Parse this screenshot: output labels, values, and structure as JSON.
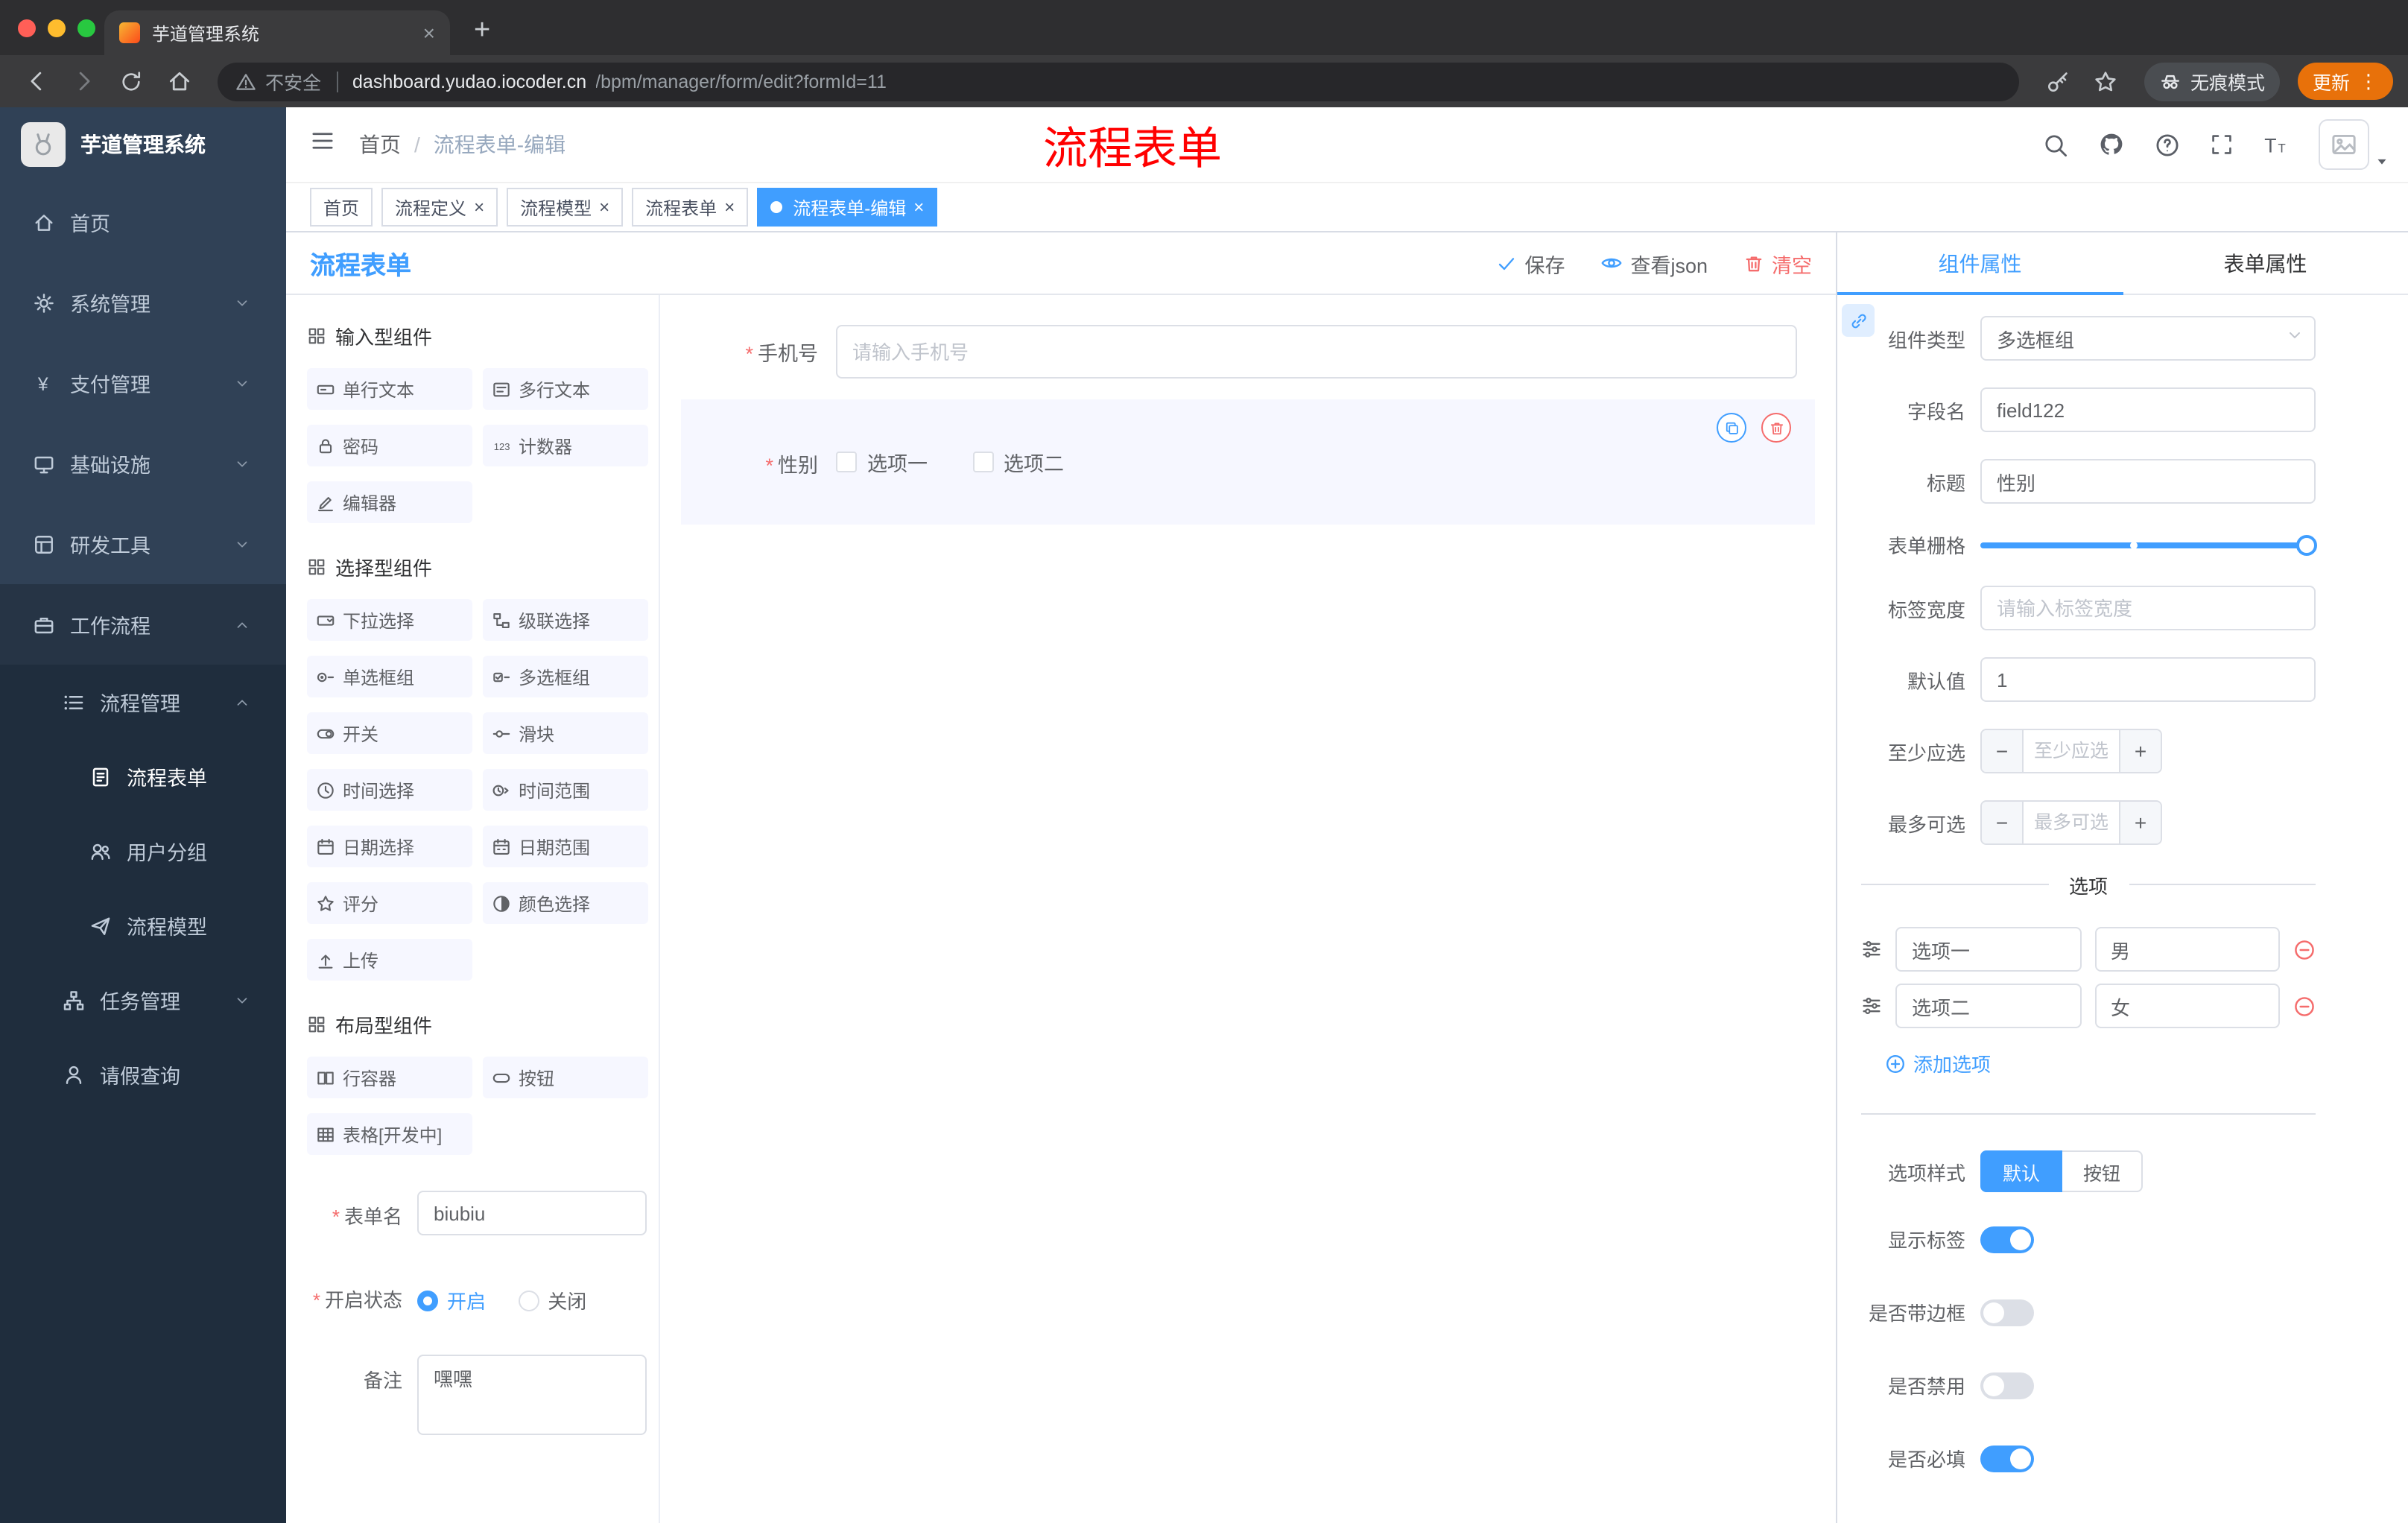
{
  "browser": {
    "tab_title": "芋道管理系统",
    "new_tab": "+",
    "tab_close": "×",
    "security_label": "不安全",
    "url_host": "dashboard.yudao.iocoder.cn",
    "url_path": "/bpm/manager/form/edit?formId=11",
    "incognito_label": "无痕模式",
    "update_label": "更新",
    "kebab": "⋮"
  },
  "sidebar": {
    "logo_title": "芋道管理系统",
    "menu": [
      {
        "name": "home",
        "label": "首页",
        "icon": "home-icon",
        "level": 1
      },
      {
        "name": "system-management",
        "label": "系统管理",
        "icon": "gear-icon",
        "level": 1,
        "chevron": "down"
      },
      {
        "name": "payment-management",
        "label": "支付管理",
        "icon": "payment-icon",
        "level": 1,
        "chevron": "down"
      },
      {
        "name": "infrastructure",
        "label": "基础设施",
        "icon": "infrastructure-icon",
        "level": 1,
        "chevron": "down"
      },
      {
        "name": "devtools",
        "label": "研发工具",
        "icon": "devtools-icon",
        "level": 1,
        "chevron": "down"
      },
      {
        "name": "workflow",
        "label": "工作流程",
        "icon": "workflow-icon",
        "level": 1,
        "chevron": "up",
        "open": true
      },
      {
        "name": "process-management",
        "label": "流程管理",
        "icon": "process-management-icon",
        "level": 2,
        "chevron": "up",
        "open": true
      },
      {
        "name": "process-form",
        "label": "流程表单",
        "icon": "process-form-icon",
        "level": 3,
        "active": true
      },
      {
        "name": "user-group",
        "label": "用户分组",
        "icon": "user-group-icon",
        "level": 3
      },
      {
        "name": "process-model",
        "label": "流程模型",
        "icon": "process-model-icon",
        "level": 3
      },
      {
        "name": "task-management",
        "label": "任务管理",
        "icon": "task-management-icon",
        "level": 2,
        "chevron": "down"
      },
      {
        "name": "leave-query",
        "label": "请假查询",
        "icon": "leave-query-icon",
        "level": 2
      }
    ]
  },
  "header": {
    "breadcrumb": [
      "首页",
      "流程表单-编辑"
    ],
    "breadcrumb_sep": "/",
    "annotation": {
      "text": "流程表单",
      "color": "#ff0000"
    }
  },
  "tags": [
    {
      "name": "home",
      "label": "首页",
      "closable": false,
      "active": false
    },
    {
      "name": "process-definition",
      "label": "流程定义",
      "closable": true,
      "active": false
    },
    {
      "name": "process-model",
      "label": "流程模型",
      "closable": true,
      "active": false
    },
    {
      "name": "process-form",
      "label": "流程表单",
      "closable": true,
      "active": false
    },
    {
      "name": "process-form-edit",
      "label": "流程表单-编辑",
      "closable": true,
      "active": true
    }
  ],
  "designer": {
    "title": "流程表单",
    "actions": [
      {
        "name": "save",
        "label": "保存",
        "icon": "check-icon",
        "type": "default"
      },
      {
        "name": "view-json",
        "label": "查看json",
        "icon": "eye-icon",
        "type": "default"
      },
      {
        "name": "clear",
        "label": "清空",
        "icon": "trash-icon",
        "type": "danger"
      }
    ]
  },
  "palette": {
    "sections": [
      {
        "name": "input-components",
        "title": "输入型组件",
        "icon": "section-icon",
        "items": [
          {
            "name": "single-line-text",
            "label": "单行文本",
            "icon": "single-line-text-icon"
          },
          {
            "name": "multi-line-text",
            "label": "多行文本",
            "icon": "multi-line-text-icon"
          },
          {
            "name": "password",
            "label": "密码",
            "icon": "password-icon"
          },
          {
            "name": "counter",
            "label": "计数器",
            "icon": "counter-icon"
          },
          {
            "name": "rich-editor",
            "label": "编辑器",
            "icon": "rich-editor-icon"
          }
        ]
      },
      {
        "name": "select-components",
        "title": "选择型组件",
        "icon": "section-icon",
        "items": [
          {
            "name": "select",
            "label": "下拉选择",
            "icon": "select-icon"
          },
          {
            "name": "cascader",
            "label": "级联选择",
            "icon": "cascader-icon"
          },
          {
            "name": "radio-group",
            "label": "单选框组",
            "icon": "radio-group-icon"
          },
          {
            "name": "checkbox-group",
            "label": "多选框组",
            "icon": "checkbox-group-icon"
          },
          {
            "name": "switch",
            "label": "开关",
            "icon": "switch-icon"
          },
          {
            "name": "slider",
            "label": "滑块",
            "icon": "slider-icon"
          },
          {
            "name": "time-picker",
            "label": "时间选择",
            "icon": "time-picker-icon"
          },
          {
            "name": "time-range",
            "label": "时间范围",
            "icon": "time-range-icon"
          },
          {
            "name": "date-picker",
            "label": "日期选择",
            "icon": "date-picker-icon"
          },
          {
            "name": "date-range",
            "label": "日期范围",
            "icon": "date-range-icon"
          },
          {
            "name": "rate",
            "label": "评分",
            "icon": "rate-icon"
          },
          {
            "name": "color-picker",
            "label": "颜色选择",
            "icon": "color-picker-icon"
          },
          {
            "name": "upload",
            "label": "上传",
            "icon": "upload-icon"
          }
        ]
      },
      {
        "name": "layout-components",
        "title": "布局型组件",
        "icon": "section-icon",
        "items": [
          {
            "name": "row-container",
            "label": "行容器",
            "icon": "row-container-icon"
          },
          {
            "name": "button",
            "label": "按钮",
            "icon": "button-icon"
          },
          {
            "name": "table",
            "label": "表格[开发中]",
            "icon": "table-icon"
          }
        ]
      }
    ],
    "form": {
      "name_label": "表单名",
      "name_value": "biubiu",
      "status_label": "开启状态",
      "status_options": [
        {
          "label": "开启",
          "checked": true
        },
        {
          "label": "关闭",
          "checked": false
        }
      ],
      "remark_label": "备注",
      "remark_value": "嘿嘿"
    }
  },
  "canvas": {
    "fields": [
      {
        "label": "手机号",
        "required": true,
        "placeholder": "请输入手机号"
      },
      {
        "label": "性别",
        "required": true,
        "options": [
          "选项一",
          "选项二"
        ],
        "selected": true
      }
    ]
  },
  "inspector": {
    "tabs": [
      {
        "name": "component-props",
        "label": "组件属性",
        "active": true
      },
      {
        "name": "form-props",
        "label": "表单属性",
        "active": false
      }
    ],
    "component_type_label": "组件类型",
    "component_type_value": "多选框组",
    "field_name_label": "字段名",
    "field_name_value": "field122",
    "title_label": "标题",
    "title_value": "性别",
    "grid_label": "表单栅格",
    "label_width_label": "标签宽度",
    "label_width_placeholder": "请输入标签宽度",
    "default_value_label": "默认值",
    "default_value": "1",
    "min_select_label": "至少应选",
    "min_select_placeholder": "至少应选",
    "max_select_label": "最多可选",
    "max_select_placeholder": "最多可选",
    "stepper_minus": "−",
    "stepper_plus": "+",
    "options_divider": "选项",
    "options": [
      {
        "label": "选项一",
        "value": "男"
      },
      {
        "label": "选项二",
        "value": "女"
      }
    ],
    "add_option_label": "添加选项",
    "option_style_label": "选项样式",
    "option_style_buttons": [
      {
        "label": "默认",
        "active": true
      },
      {
        "label": "按钮",
        "active": false
      }
    ],
    "switches": [
      {
        "name": "show-label",
        "label": "显示标签",
        "on": true
      },
      {
        "name": "with-border",
        "label": "是否带边框",
        "on": false
      },
      {
        "name": "disabled",
        "label": "是否禁用",
        "on": false
      },
      {
        "name": "required",
        "label": "是否必填",
        "on": true
      }
    ]
  },
  "colors": {
    "accent": "#409eff",
    "danger": "#f56c6c",
    "update_pill": "#e8710a",
    "sidebar_bg": "#304156",
    "sidebar_sub_bg": "#1f2d3d"
  }
}
